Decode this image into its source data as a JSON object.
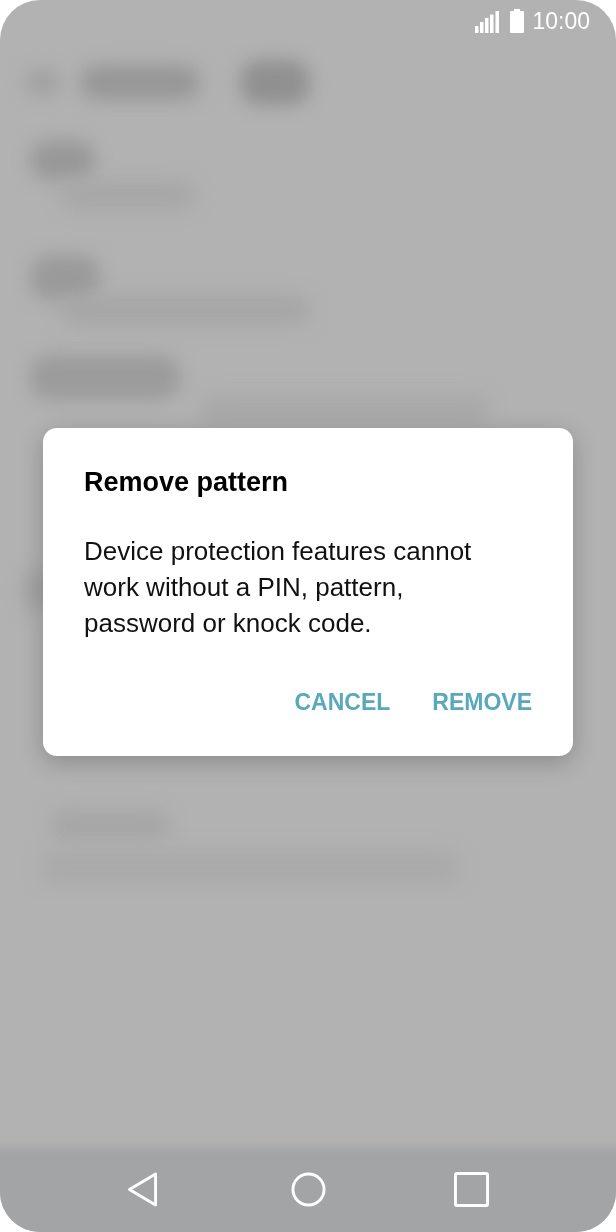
{
  "status_bar": {
    "time": "10:00"
  },
  "dialog": {
    "title": "Remove pattern",
    "message": "Device protection features cannot work without a PIN, pattern, password or knock code.",
    "buttons": [
      {
        "label": "CANCEL"
      },
      {
        "label": "REMOVE"
      }
    ]
  },
  "navigation_bar": {
    "buttons": [
      {
        "kind": "back"
      },
      {
        "kind": "home"
      },
      {
        "kind": "recents"
      }
    ]
  }
}
